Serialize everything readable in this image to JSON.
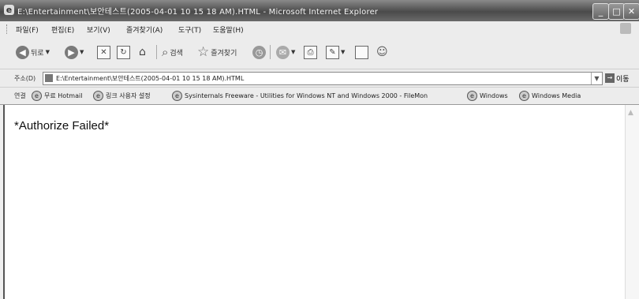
{
  "window": {
    "title": "E:\\Entertainment\\보안테스트(2005-04-01 10 15 18 AM).HTML - Microsoft Internet Explorer",
    "min_glyph": "_",
    "max_glyph": "□",
    "close_glyph": "✕"
  },
  "menu": {
    "items": [
      "파일(F)",
      "편집(E)",
      "보기(V)",
      "즐겨찾기(A)",
      "도구(T)",
      "도움말(H)"
    ]
  },
  "toolbar": {
    "back_label": "뒤로",
    "search_label": "검색",
    "favorites_label": "즐겨찾기"
  },
  "address": {
    "label": "주소(D)",
    "value": "E:\\Entertainment\\보안테스트(2005-04-01 10 15 18 AM).HTML",
    "go_label": "이동"
  },
  "links": {
    "label": "연결",
    "items": [
      "무료 Hotmail",
      "링크 사용자 설정",
      "Sysinternals Freeware - Utilities for Windows NT and Windows 2000 - FileMon",
      "Windows",
      "Windows Media"
    ]
  },
  "content": {
    "message": "*Authorize Failed*"
  }
}
